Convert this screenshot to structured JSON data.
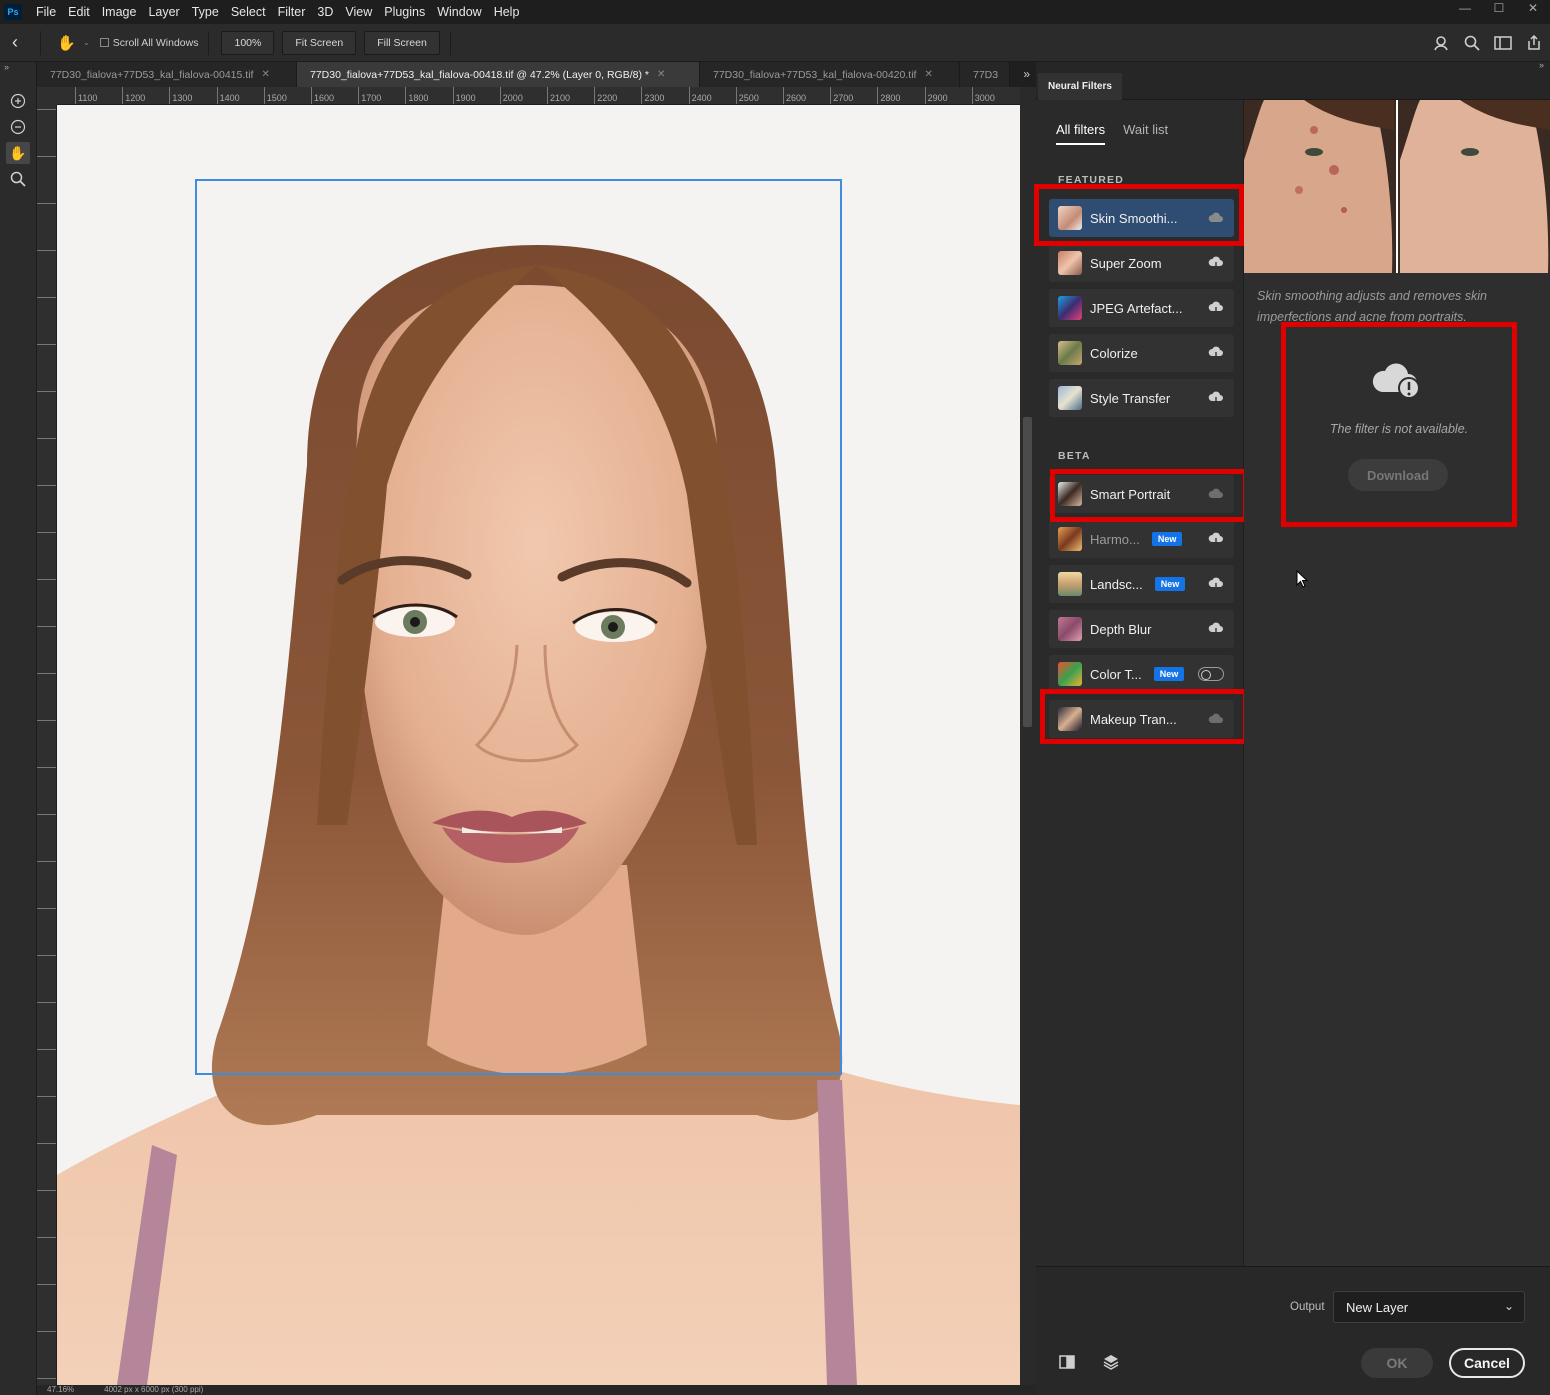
{
  "app": {
    "logo": "Ps"
  },
  "menu": [
    "File",
    "Edit",
    "Image",
    "Layer",
    "Type",
    "Select",
    "Filter",
    "3D",
    "View",
    "Plugins",
    "Window",
    "Help"
  ],
  "window_controls": {
    "minimize": "—",
    "maximize": "☐",
    "close": "✕"
  },
  "options": {
    "scroll_all_windows": "Scroll All Windows",
    "zoom": "100%",
    "fit_screen": "Fit Screen",
    "fill_screen": "Fill Screen"
  },
  "tabs": [
    {
      "label": "77D30_fialova+77D53_kal_fialova-00415.tif",
      "active": false
    },
    {
      "label": "77D30_fialova+77D53_kal_fialova-00418.tif @ 47.2% (Layer 0, RGB/8) *",
      "active": true
    },
    {
      "label": "77D30_fialova+77D53_kal_fialova-00420.tif",
      "active": false
    },
    {
      "label": "77D3",
      "active": false
    }
  ],
  "ruler_labels": [
    "1100",
    "1200",
    "1300",
    "1400",
    "1500",
    "1600",
    "1700",
    "1800",
    "1900",
    "2000",
    "2100",
    "2200",
    "2300",
    "2400",
    "2500",
    "2600",
    "2700",
    "2800",
    "2900",
    "3000"
  ],
  "status": {
    "zoom": "47.16%",
    "doc_size": "4002 px x 6000 px (300 ppi)"
  },
  "neural_filters": {
    "panel_title": "Neural Filters",
    "subtabs": [
      "All filters",
      "Wait list"
    ],
    "featured_head": "FEATURED",
    "beta_head": "BETA",
    "featured": [
      {
        "name": "Skin Smoothi...",
        "selected": true
      },
      {
        "name": "Super Zoom"
      },
      {
        "name": "JPEG Artefact..."
      },
      {
        "name": "Colorize"
      },
      {
        "name": "Style Transfer"
      }
    ],
    "beta": [
      {
        "name": "Smart Portrait"
      },
      {
        "name": "Harmo...",
        "badge": "New",
        "dim": true
      },
      {
        "name": "Landsc...",
        "badge": "New"
      },
      {
        "name": "Depth Blur"
      },
      {
        "name": "Color T...",
        "badge": "New",
        "toggle": true
      },
      {
        "name": "Makeup Tran..."
      }
    ],
    "description": "Skin smoothing adjusts and removes skin imperfections and acne from portraits.",
    "not_available": "The filter is not available.",
    "download": "Download",
    "output_label": "Output",
    "output_value": "New Layer",
    "ok": "OK",
    "cancel": "Cancel"
  },
  "colors": {
    "accent_selection": "#3f8cdc",
    "highlight_box": "#e00000",
    "selected_filter": "#2f4d72",
    "badge": "#1473e6"
  }
}
